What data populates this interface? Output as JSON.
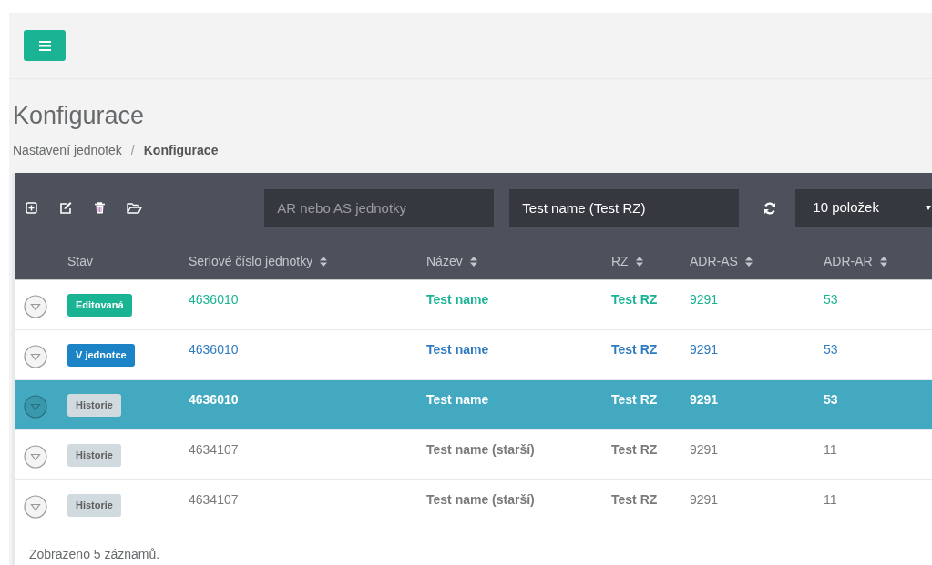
{
  "title": "Konfigurace",
  "breadcrumb": {
    "separator": "/",
    "items": [
      {
        "label": "Nastavení jednotek",
        "current": false
      },
      {
        "label": "Konfigurace",
        "current": true
      }
    ]
  },
  "toolbar": {
    "fields": [
      {
        "placeholder": "AR nebo AS jednotky"
      },
      {
        "value": "Test name (Test RZ)"
      }
    ],
    "page_size": "10 položek"
  },
  "table": {
    "columns": [
      {
        "label": "Stav",
        "sortable": false
      },
      {
        "label": "Seriové číslo jednotky",
        "sortable": true
      },
      {
        "label": "Název",
        "sortable": true
      },
      {
        "label": "RZ",
        "sortable": true
      },
      {
        "label": "ADR-AS",
        "sortable": true
      },
      {
        "label": "ADR-AR",
        "sortable": true
      }
    ],
    "rows": [
      {
        "status": "Editovaná",
        "kind": "edited",
        "serial": "4636010",
        "name": "Test name",
        "rz": "Test RZ",
        "adr_as": "9291",
        "adr_ar": "53",
        "selected": false
      },
      {
        "status": "V jednotce",
        "kind": "in_unit",
        "serial": "4636010",
        "name": "Test name",
        "rz": "Test RZ",
        "adr_as": "9291",
        "adr_ar": "53",
        "selected": false
      },
      {
        "status": "Historie",
        "kind": "history",
        "serial": "4636010",
        "name": "Test name",
        "rz": "Test RZ",
        "adr_as": "9291",
        "adr_ar": "53",
        "selected": true
      },
      {
        "status": "Historie",
        "kind": "history",
        "serial": "4634107",
        "name": "Test name (starší)",
        "rz": "Test RZ",
        "adr_as": "9291",
        "adr_ar": "11",
        "selected": false
      },
      {
        "status": "Historie",
        "kind": "history",
        "serial": "4634107",
        "name": "Test name (starší)",
        "rz": "Test RZ",
        "adr_as": "9291",
        "adr_ar": "11",
        "selected": false
      }
    ]
  },
  "footer": "Zobrazeno 5 záznamů."
}
